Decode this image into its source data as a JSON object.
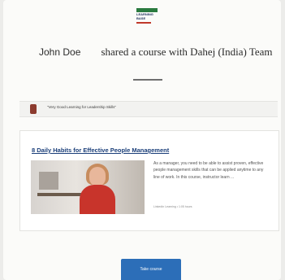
{
  "header": {
    "logo_line1": "LEARNING",
    "logo_line2": "BASE"
  },
  "share": {
    "sender": "John Doe",
    "message": "shared a course with Dahej (India) Team"
  },
  "quote": {
    "text": "\"Very Good Learning for Leadership Skills\""
  },
  "course": {
    "title": "8 Daily Habits for Effective People Management",
    "description": "As a manager, you need to be able to assist proven, effective people management skills that can be applied anytime to any line of work. In this course, instructor learn ...",
    "meta": "LinkedIn Learning • 1:05 hours"
  },
  "cta": {
    "label": "Take course"
  },
  "colors": {
    "brand_blue": "#2c6eb8",
    "link_blue": "#1b3f7a",
    "accent_green": "#2a7a3f"
  }
}
